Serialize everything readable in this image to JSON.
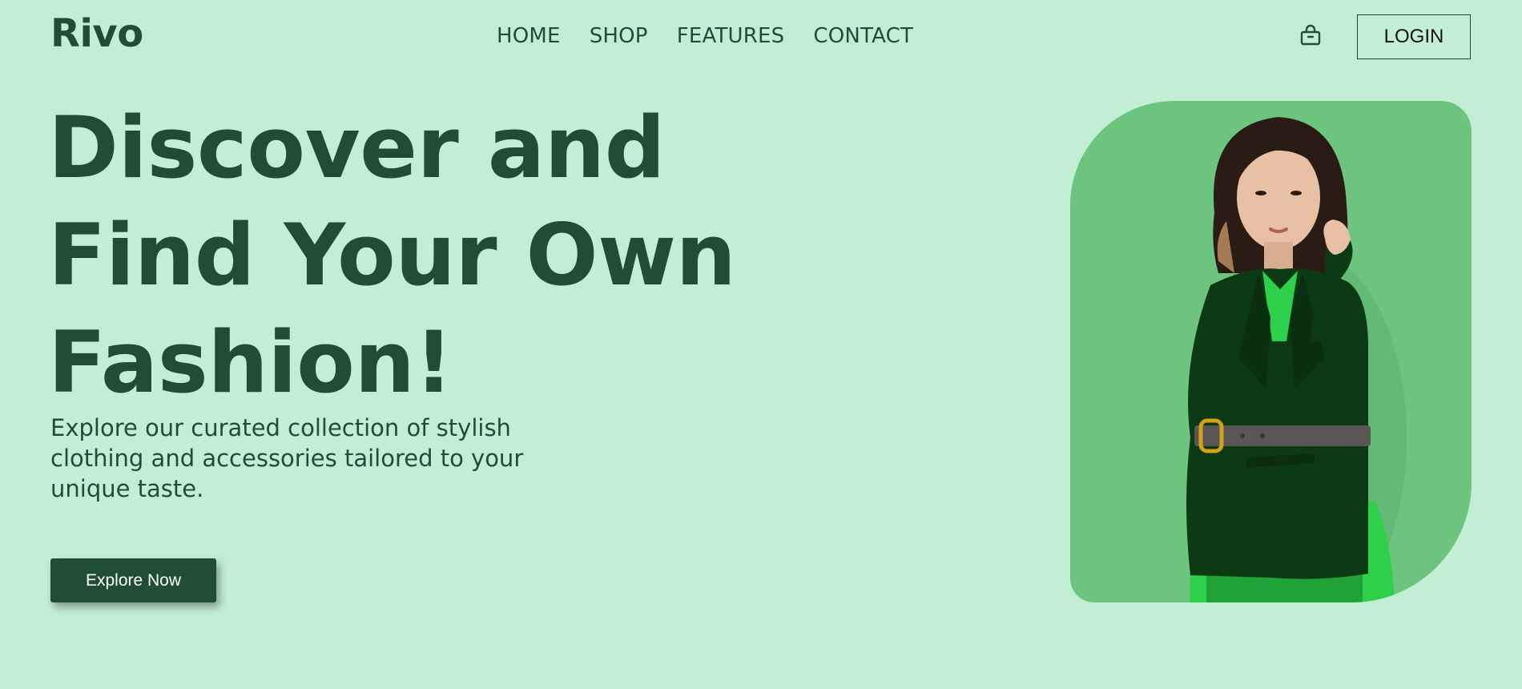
{
  "header": {
    "brand": "Rivo",
    "nav": [
      "HOME",
      "SHOP",
      "FEATURES",
      "CONTACT"
    ],
    "bag_icon": "shopping-bag-icon",
    "login_label": "LOGIN"
  },
  "hero": {
    "title_lines": [
      "Discover and",
      "Find Your Own",
      "Fashion!"
    ],
    "subtitle": "Explore our curated collection of stylish clothing and accessories tailored to your unique taste.",
    "cta_label": "Explore Now"
  },
  "colors": {
    "background": "#c2eed3",
    "primary": "#214d33",
    "card": "#6dc47f",
    "jacket": "#0c3a14",
    "dress": "#2ecf4a"
  }
}
